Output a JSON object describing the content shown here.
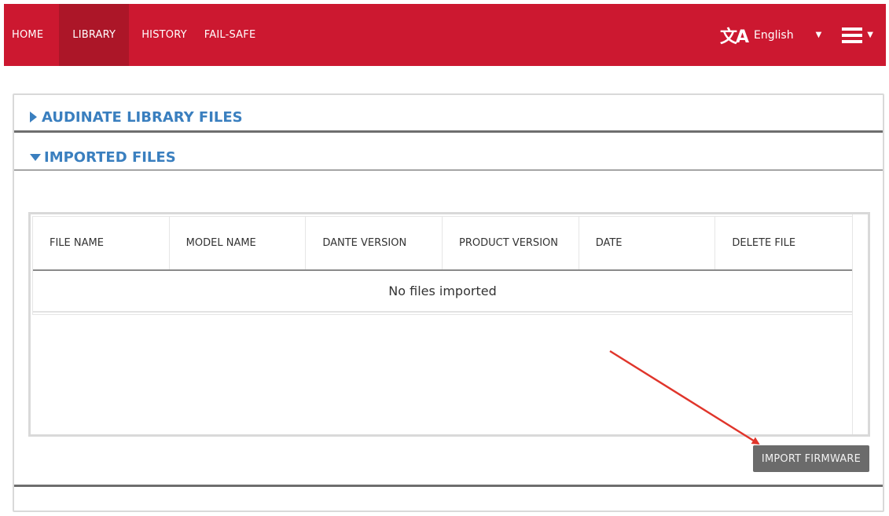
{
  "nav": {
    "items": [
      {
        "label": "HOME"
      },
      {
        "label": "LIBRARY"
      },
      {
        "label": "HISTORY"
      },
      {
        "label": "FAIL-SAFE"
      }
    ],
    "language": "English"
  },
  "sections": {
    "audinate": {
      "title": "AUDINATE LIBRARY FILES"
    },
    "imported": {
      "title": "IMPORTED FILES"
    }
  },
  "table": {
    "columns": [
      "FILE NAME",
      "MODEL NAME",
      "DANTE VERSION",
      "PRODUCT VERSION",
      "DATE",
      "DELETE FILE"
    ],
    "empty_message": "No files imported"
  },
  "import_button": "IMPORT FIRMWARE",
  "colors": {
    "topbar": "#cc1830",
    "topbar_active": "#ac1628",
    "section_title": "#3a7fbf",
    "button": "#6b6b6b",
    "annotation_arrow": "#e0352b"
  },
  "icons": {
    "language": "translate-icon",
    "menu": "hamburger-menu-icon"
  }
}
